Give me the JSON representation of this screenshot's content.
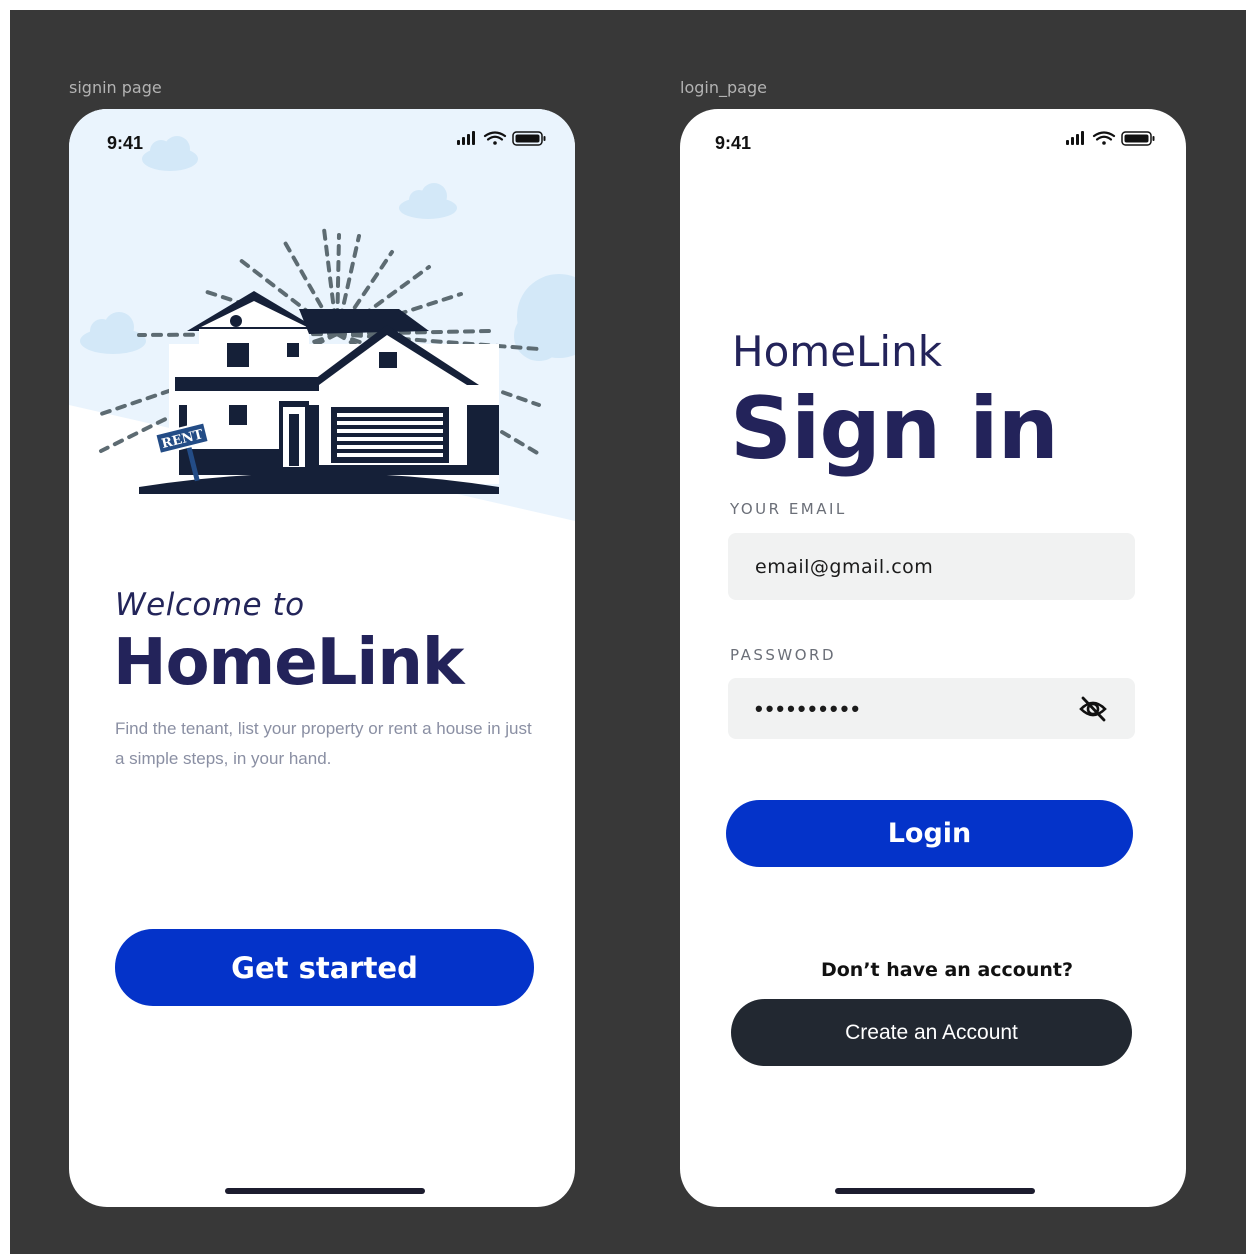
{
  "frames": {
    "left_label": "signin page",
    "right_label": "login_page"
  },
  "status_bar": {
    "time": "9:41"
  },
  "welcome_screen": {
    "illustration_sign": "RENT",
    "welcome_text": "Welcome to",
    "brand": "HomeLink",
    "tagline": "Find the tenant, list your property or rent a house in just a simple steps, in your hand.",
    "cta_label": "Get started"
  },
  "login_screen": {
    "brand": "HomeLink",
    "title": "Sign in",
    "email_label": "YOUR EMAIL",
    "email_value": "email@gmail.com",
    "password_label": "PASSWORD",
    "password_value": "••••••••••",
    "login_label": "Login",
    "no_account_text": "Don’t have an account?",
    "create_account_label": "Create an Account"
  },
  "colors": {
    "canvas": "#383838",
    "primary": "#0433c9",
    "brand_text": "#23235a",
    "dark_button": "#222831",
    "field_bg": "#f1f2f2",
    "hero_bg": "#eaf4fd"
  },
  "icons": [
    "signal-icon",
    "wifi-icon",
    "battery-icon",
    "eye-off-icon",
    "house-illustration",
    "cloud-icon"
  ]
}
